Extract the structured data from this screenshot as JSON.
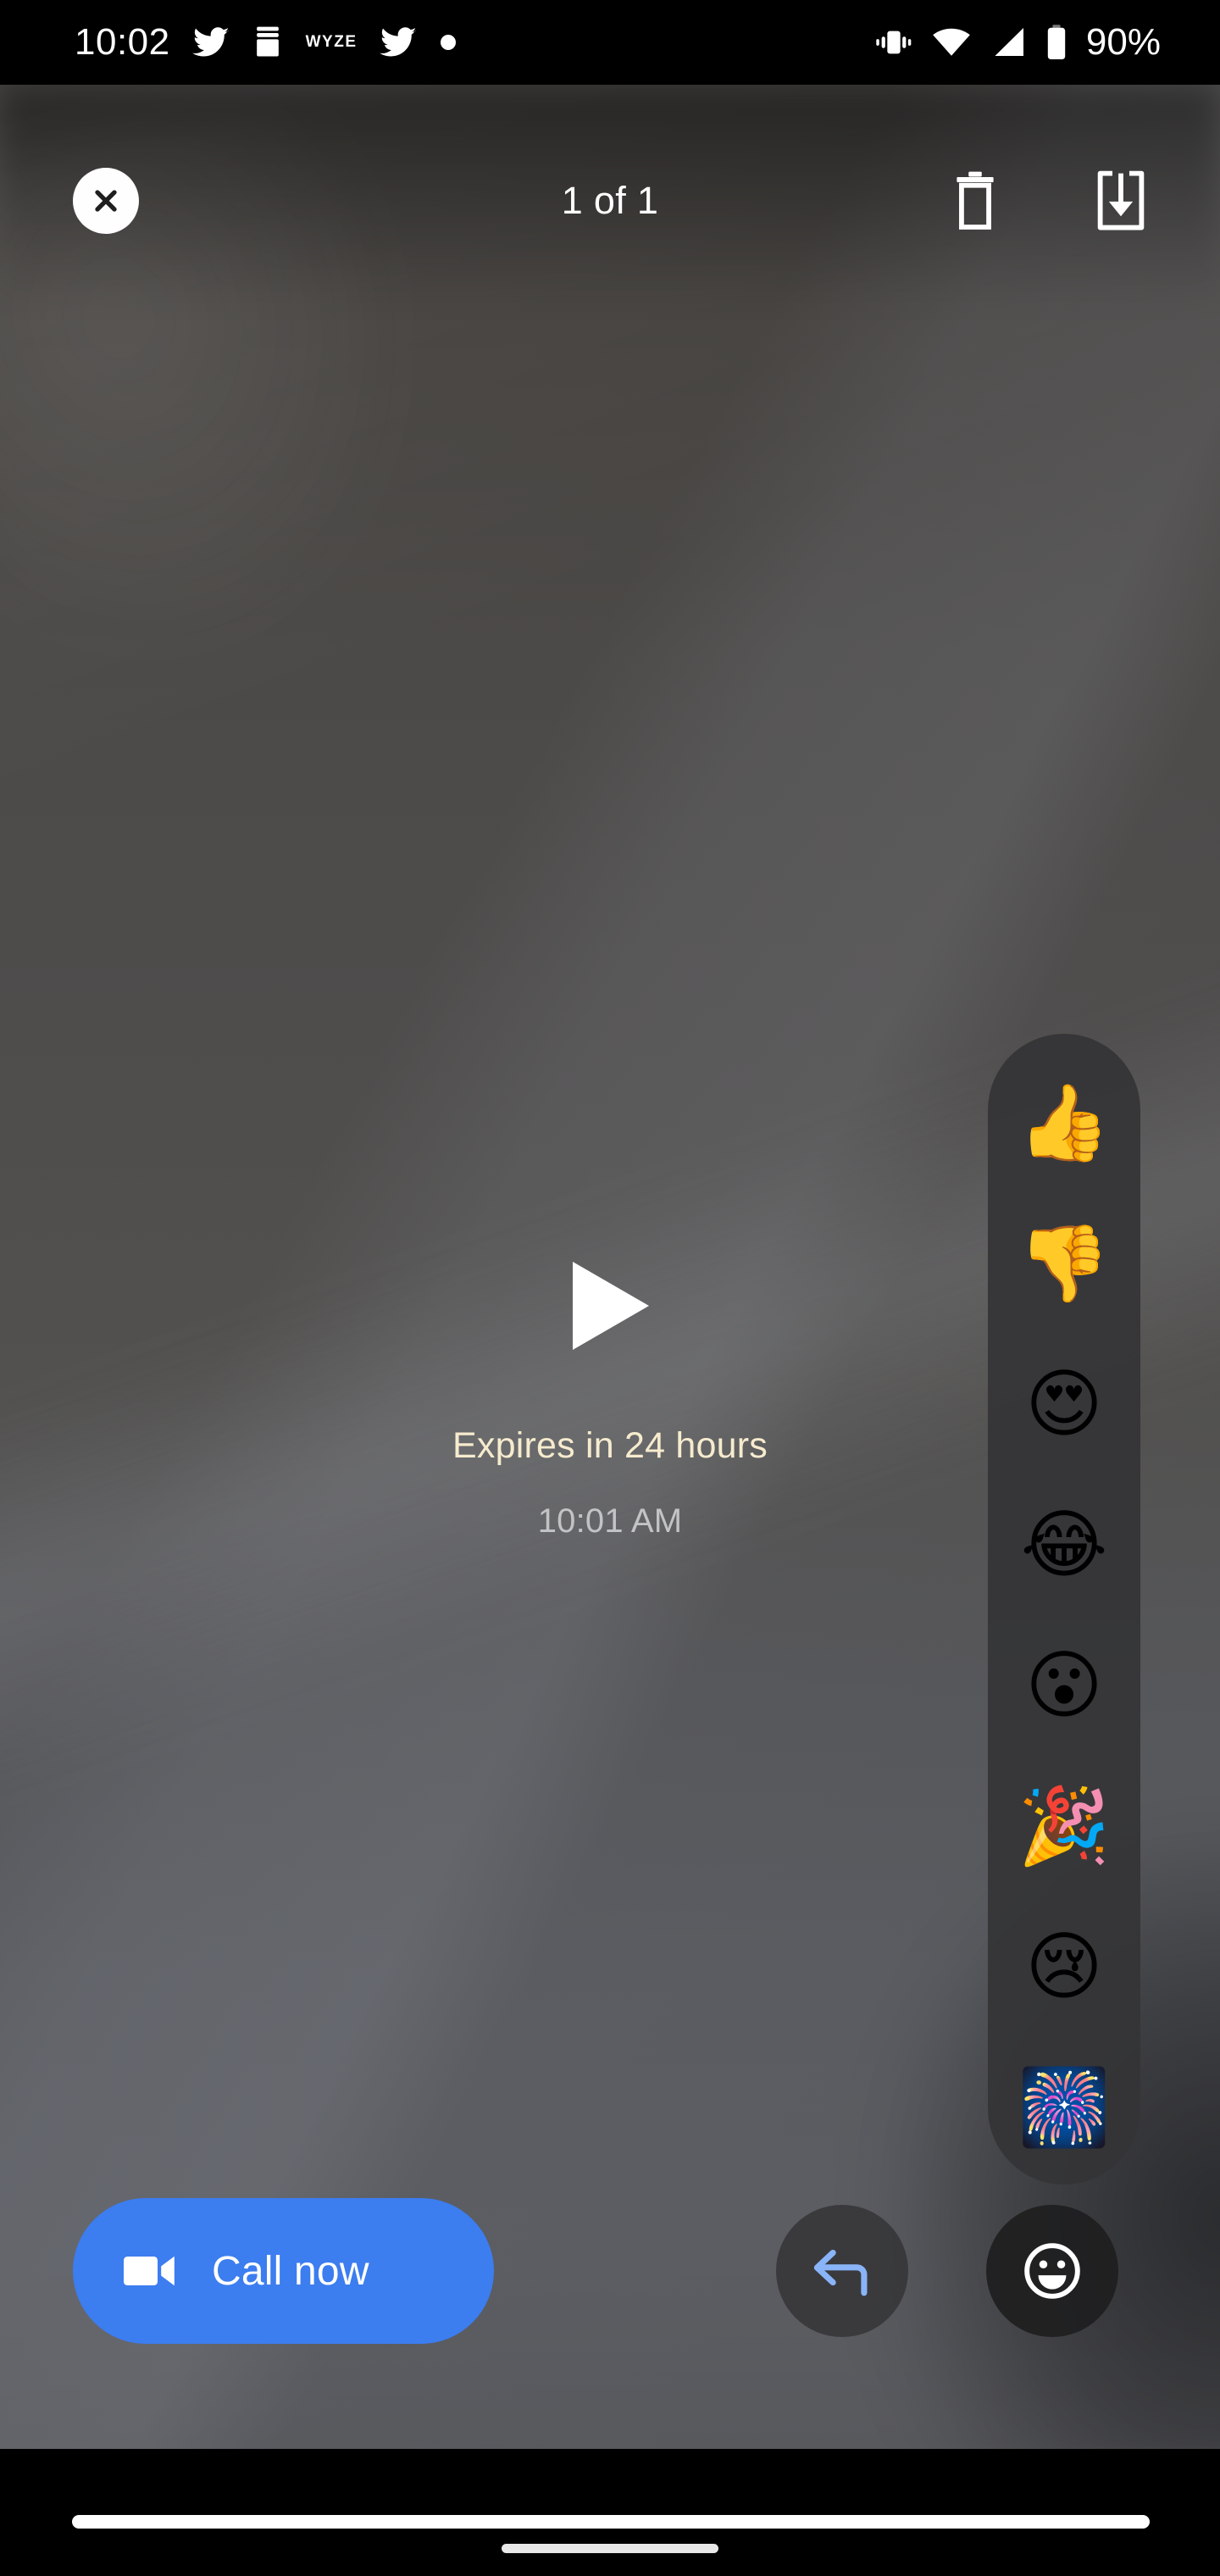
{
  "status_bar": {
    "clock": "10:02",
    "battery_percent": "90%",
    "left_icons": [
      "twitter-icon",
      "app-stack-icon",
      "wyze-icon",
      "twitter-icon",
      "dot-icon"
    ],
    "wyze_label": "WYZE",
    "right_icons": [
      "vibrate-icon",
      "wifi-icon",
      "cellular-signal-icon",
      "battery-icon"
    ]
  },
  "top_toolbar": {
    "close_icon": "close-icon",
    "pager_label": "1 of 1",
    "delete_icon": "trash-icon",
    "save_icon": "download-to-device-icon"
  },
  "media": {
    "play_icon": "play-icon",
    "expiry_text": "Expires in 24 hours",
    "timestamp": "10:01 AM",
    "expiry_color": "#F6EBCE",
    "timestamp_color": "#C2C3C4"
  },
  "reactions": [
    {
      "name": "thumbs-up",
      "glyph": "👍"
    },
    {
      "name": "thumbs-down",
      "glyph": "👎"
    },
    {
      "name": "heart-eyes",
      "glyph": "😍"
    },
    {
      "name": "tears-of-joy",
      "glyph": "😂"
    },
    {
      "name": "open-mouth",
      "glyph": "😮"
    },
    {
      "name": "party-popper",
      "glyph": "🎉"
    },
    {
      "name": "crying-face",
      "glyph": "😢"
    },
    {
      "name": "fireworks",
      "glyph": "🎆"
    }
  ],
  "bottom_bar": {
    "call_label": "Call now",
    "call_icon": "video-camera-icon",
    "call_color": "#3C7DF0",
    "reply_icon": "reply-arrow-icon",
    "reply_icon_color": "#8AB4F8",
    "emoji_picker_icon": "smiley-face-icon"
  },
  "system_nav": {
    "nav_bar": "home-indicator",
    "gesture_handle": "gesture-handle"
  }
}
